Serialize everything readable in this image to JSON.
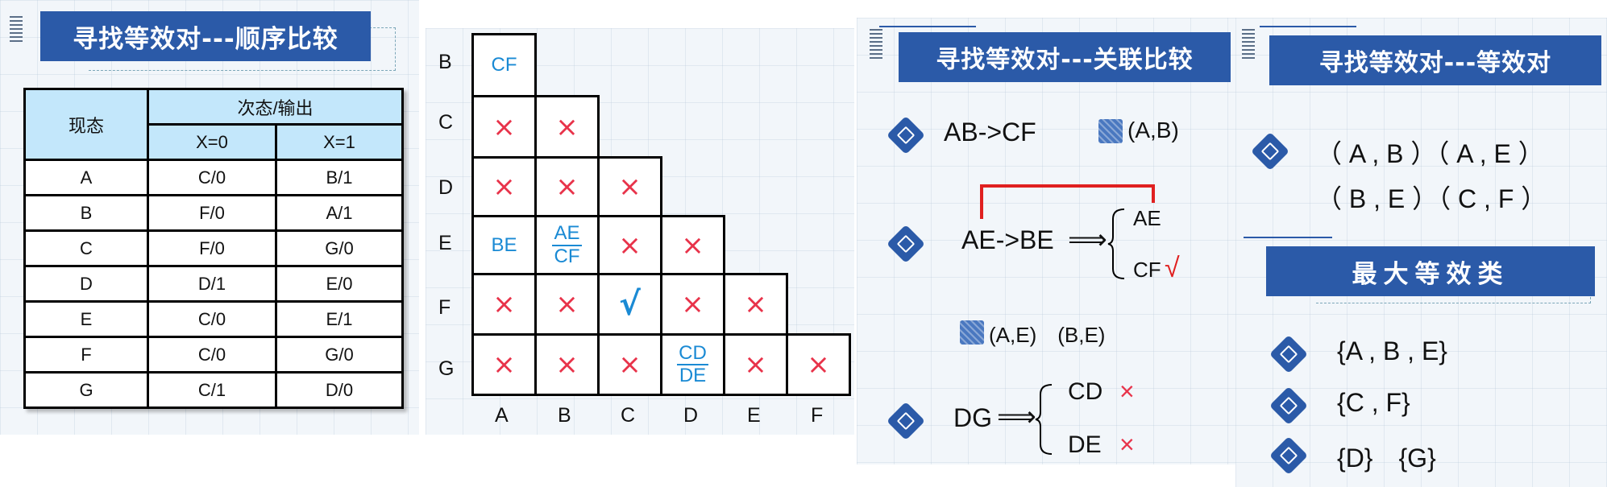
{
  "panel1": {
    "title": "寻找等效对---顺序比较",
    "header_present": "现态",
    "header_next": "次态/输出",
    "header_x0": "X=0",
    "header_x1": "X=1",
    "rows": [
      {
        "state": "A",
        "x0": "C/0",
        "x1": "B/1"
      },
      {
        "state": "B",
        "x0": "F/0",
        "x1": "A/1"
      },
      {
        "state": "C",
        "x0": "F/0",
        "x1": "G/0"
      },
      {
        "state": "D",
        "x0": "D/1",
        "x1": "E/0"
      },
      {
        "state": "E",
        "x0": "C/0",
        "x1": "E/1"
      },
      {
        "state": "F",
        "x0": "C/0",
        "x1": "G/0"
      },
      {
        "state": "G",
        "x0": "C/1",
        "x1": "D/0"
      }
    ]
  },
  "panel2": {
    "row_labels": [
      "B",
      "C",
      "D",
      "E",
      "F",
      "G"
    ],
    "col_labels": [
      "A",
      "B",
      "C",
      "D",
      "E",
      "F"
    ],
    "cross_symbol": "×",
    "check_symbol": "√",
    "cells": {
      "BA": "CF",
      "EA": "BE",
      "EB_top": "AE",
      "EB_bottom": "CF",
      "GD_top": "CD",
      "GD_bottom": "DE"
    }
  },
  "panel3": {
    "title": "寻找等效对---关联比较",
    "item1": "AB->CF",
    "item1_note": "(A,B)",
    "item2": "AE->BE",
    "item2_upper": "AE",
    "item2_lower": "CF",
    "check_symbol": "√",
    "note2": "(A,E)　(B,E)",
    "item3": "DG",
    "item3_upper": "CD",
    "item3_lower": "DE",
    "cross_symbol": "×",
    "arrow": "⟹"
  },
  "panel4": {
    "title": "寻找等效对---等效对",
    "pairs_line1": "（ A , B ）（ A , E ）",
    "pairs_line2": "（ B , E ）（ C , F ）",
    "subtitle": "最大等效类",
    "class1": "{A , B , E}",
    "class2": "{C , F}",
    "class3": "{D}　{G}"
  },
  "colors": {
    "title_blue": "#2b5aa8",
    "header_blue": "#c3e7fb",
    "cross_red": "#e8334a",
    "pair_blue": "#1a8ad4",
    "bracket_red": "#e02020"
  }
}
